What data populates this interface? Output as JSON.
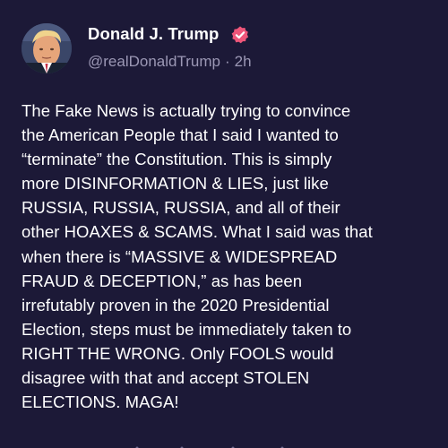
{
  "post": {
    "author": {
      "display_name": "Donald J. Trump",
      "handle": "@realDonaldTrump",
      "separator": "·",
      "time_ago": "2h",
      "verified_icon": "verified-badge-icon",
      "verified_color": "#f0567a"
    },
    "body": "The Fake News is actually trying to convince\nthe American People that I said I wanted to\n“terminate” the Constitution. This is simply\nmore DISINFORMATION & LIES, just like\nRUSSIA, RUSSIA, RUSSIA, and all of their\nother HOAXES & SCAMS. What I said was that\nwhen there is “MASSIVE & WIDESPREAD\nFRAUD & DECEPTION,” as has been\nirrefutably proven in the 2020 Presidential\nElection, steps must be immediately taken to\nRIGHT THE WRONG. Only FOOLS would\ndisagree with that and accept STOLEN\nELECTIONS. MAGA!"
  },
  "theme": {
    "background": "#1c1937",
    "text": "#ffffff",
    "muted": "#9c98b5"
  }
}
